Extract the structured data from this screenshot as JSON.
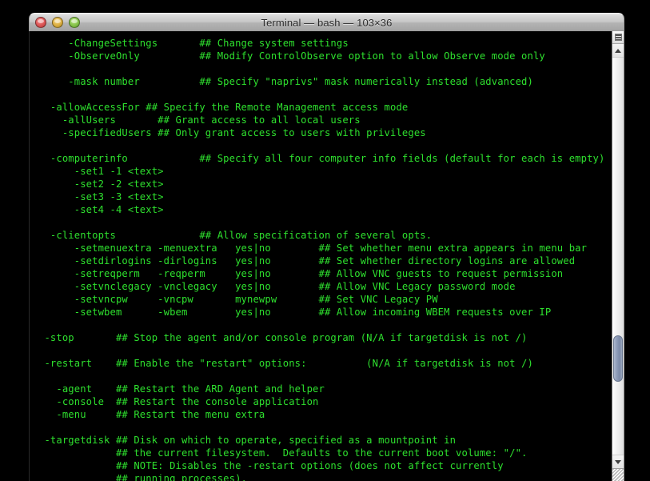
{
  "window": {
    "title": "Terminal — bash — 103×36",
    "app": "Terminal",
    "shell": "bash",
    "size": "103×36",
    "controls": {
      "close_label": "",
      "minimize_label": "",
      "zoom_label": ""
    }
  },
  "colors": {
    "terminal_background": "#000000",
    "terminal_foreground": "#2ee02e",
    "titlebar_text": "#2a2a2a",
    "scrollbar_thumb": "#8e9cb8",
    "close_button": "#e05b5b",
    "minimize_button": "#e0b348",
    "zoom_button": "#8cc850"
  },
  "scrollbar": {
    "up_arrow_icon": "triangle-up-icon",
    "down_arrow_icon": "triangle-down-icon",
    "menu_icon": "scrollbar-menu-icon",
    "resize_grip_icon": "resize-grip-icon",
    "thumb_position_percent": 70
  },
  "terminal": {
    "columns": 103,
    "rows": 36,
    "lines": [
      "     -ChangeSettings       ## Change system settings",
      "     -ObserveOnly          ## Modify ControlObserve option to allow Observe mode only",
      "",
      "     -mask number          ## Specify \"naprivs\" mask numerically instead (advanced)",
      "",
      "  -allowAccessFor ## Specify the Remote Management access mode",
      "    -allUsers       ## Grant access to all local users",
      "    -specifiedUsers ## Only grant access to users with privileges",
      "",
      "  -computerinfo            ## Specify all four computer info fields (default for each is empty)",
      "      -set1 -1 <text>",
      "      -set2 -2 <text>",
      "      -set3 -3 <text>",
      "      -set4 -4 <text>",
      "",
      "  -clientopts              ## Allow specification of several opts.",
      "      -setmenuextra -menuextra   yes|no        ## Set whether menu extra appears in menu bar",
      "      -setdirlogins -dirlogins   yes|no        ## Set whether directory logins are allowed",
      "      -setreqperm   -reqperm     yes|no        ## Allow VNC guests to request permission",
      "      -setvnclegacy -vnclegacy   yes|no        ## Allow VNC Legacy password mode",
      "      -setvncpw     -vncpw       mynewpw       ## Set VNC Legacy PW",
      "      -setwbem      -wbem        yes|no        ## Allow incoming WBEM requests over IP",
      "",
      " -stop       ## Stop the agent and/or console program (N/A if targetdisk is not /)",
      "",
      " -restart    ## Enable the \"restart\" options:          (N/A if targetdisk is not /)",
      "",
      "   -agent    ## Restart the ARD Agent and helper",
      "   -console  ## Restart the console application",
      "   -menu     ## Restart the menu extra",
      "",
      " -targetdisk ## Disk on which to operate, specified as a mountpoint in",
      "             ## the current filesystem.  Defaults to the current boot volume: \"/\".",
      "             ## NOTE: Disables the -restart options (does not affect currently",
      "             ## running processes)."
    ]
  }
}
